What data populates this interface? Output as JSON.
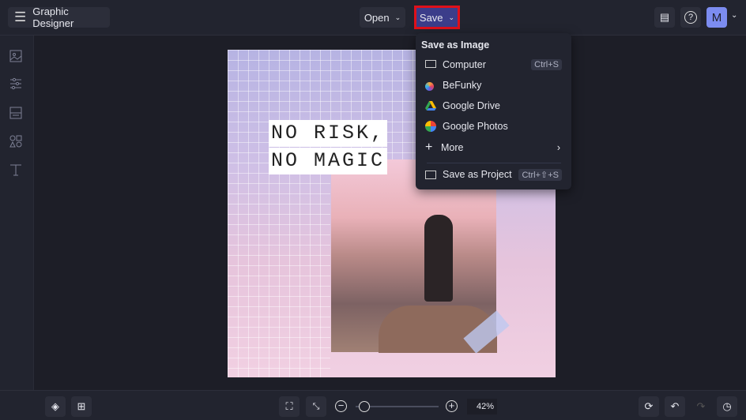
{
  "header": {
    "title": "Graphic Designer",
    "open_label": "Open",
    "save_label": "Save",
    "avatar_initial": "M"
  },
  "save_menu": {
    "heading": "Save as Image",
    "items": [
      {
        "label": "Computer",
        "shortcut": "Ctrl+S"
      },
      {
        "label": "BeFunky"
      },
      {
        "label": "Google Drive"
      },
      {
        "label": "Google Photos"
      },
      {
        "label": "More"
      },
      {
        "label": "Save as Project",
        "shortcut": "Ctrl+⇧+S"
      }
    ]
  },
  "canvas": {
    "text_line1": "NO RISK,",
    "text_line2": "NO MAGIC"
  },
  "bottom": {
    "zoom": "42%",
    "zoom_level": 0.1
  },
  "colors": {
    "accent": "#3b3d8a",
    "highlight": "#e0101a",
    "avatar": "#7c8cf0"
  }
}
